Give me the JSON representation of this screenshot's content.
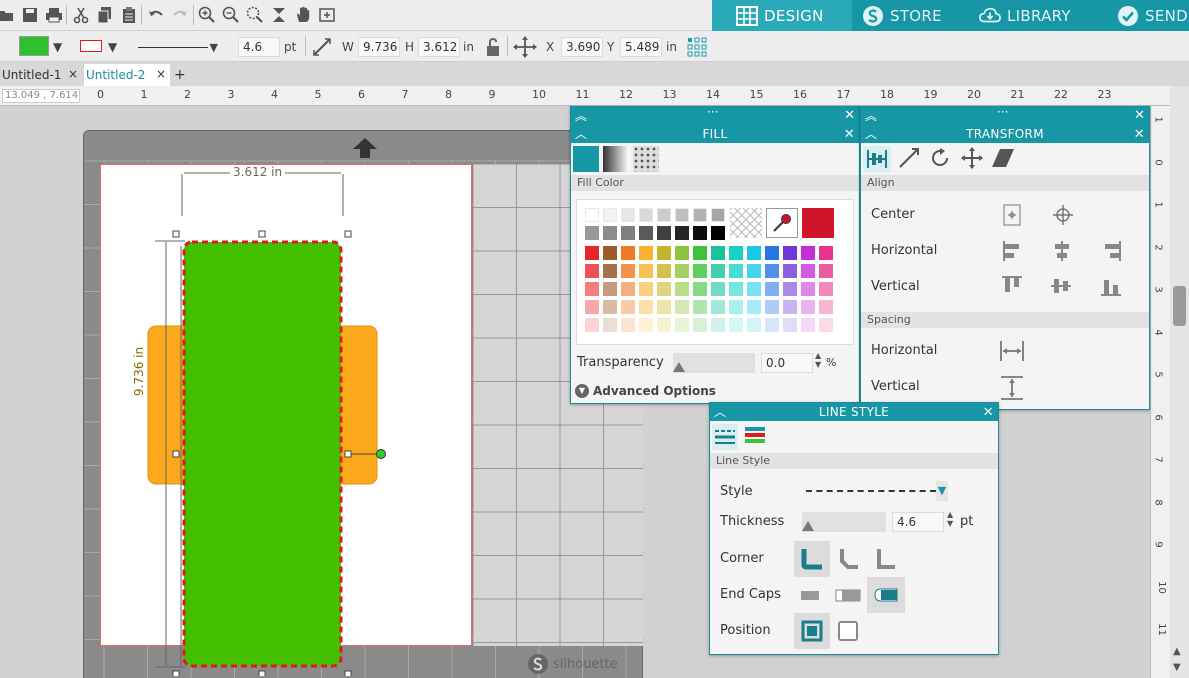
{
  "nav": {
    "design": "DESIGN",
    "store": "STORE",
    "library": "LIBRARY",
    "send": "SEND"
  },
  "propbar": {
    "fill_color": "#2ec02e",
    "line_thickness": "4.6",
    "line_unit": "pt",
    "w_label": "W",
    "w_value": "9.736",
    "h_label": "H",
    "h_value": "3.612",
    "size_unit": "in",
    "x_label": "X",
    "x_value": "3.690",
    "y_label": "Y",
    "y_value": "5.489",
    "pos_unit": "in"
  },
  "tabs": [
    "Untitled-1",
    "Untitled-2"
  ],
  "tab_add": "+",
  "tab_close": "×",
  "coords": "13.049 , 7.614",
  "ruler": {
    "h": [
      "0",
      "1",
      "2",
      "3",
      "4",
      "5",
      "6",
      "7",
      "8",
      "9",
      "10",
      "11",
      "12",
      "13",
      "14",
      "15",
      "16",
      "17",
      "18",
      "19",
      "20",
      "21",
      "22",
      "23"
    ],
    "v": [
      "1",
      "0",
      "1",
      "2",
      "3",
      "4",
      "5",
      "6",
      "7",
      "8",
      "9",
      "10",
      "11"
    ]
  },
  "canvas": {
    "width_dim": "3.612 in",
    "height_dim": "9.736 in",
    "logo": "silhouette",
    "green": "#43c000",
    "orange": "#fba81a",
    "dash": "#e0191f"
  },
  "fill_panel": {
    "title": "FILL",
    "section": "Fill Color",
    "transparency_label": "Transparency",
    "transparency_value": "0.0",
    "transparency_unit": "%",
    "advanced": "Advanced Options",
    "current_color": "#cf1628",
    "palette": [
      [
        "#ffffff",
        "#f2f2f2",
        "#e6e6e6",
        "#d9d9d9",
        "#cccccc",
        "#bfbfbf",
        "#b3b3b3",
        "#a6a6a6"
      ],
      [
        "#999999",
        "#8c8c8c",
        "#7f7f7f",
        "#595959",
        "#404040",
        "#262626",
        "#0d0d0d",
        "#000000"
      ],
      [
        "#e6262b",
        "#9a5a2e",
        "#ee7b23",
        "#f7b233",
        "#c2b42b",
        "#8cc43f",
        "#3ec23e",
        "#1bc19a",
        "#18d1c7",
        "#1ac7e4",
        "#2677e5",
        "#6d36d9",
        "#c62ed8",
        "#e8348b"
      ],
      [
        "#ef5052",
        "#a66f4e",
        "#f2924b",
        "#f8c154",
        "#d1c34d",
        "#a3d061",
        "#60cd5f",
        "#41cfad",
        "#45dcd4",
        "#47d3ed",
        "#5090ea",
        "#8b5fe0",
        "#d25be0",
        "#ed5ca1"
      ],
      [
        "#f37d7e",
        "#c69a7d",
        "#f6ae7b",
        "#fad07f",
        "#dfd47d",
        "#bcdc8a",
        "#87d986",
        "#70dbc3",
        "#77e6e0",
        "#78e0f2",
        "#80aff0",
        "#a98ae8",
        "#de88e8",
        "#f28ab9"
      ],
      [
        "#f7a9aa",
        "#d9bba5",
        "#f9caa6",
        "#fce0aa",
        "#ebe3aa",
        "#d3e8b2",
        "#aee6ad",
        "#a0e8d7",
        "#a7efeb",
        "#a8eaf6",
        "#adcdf5",
        "#c8b5f0",
        "#e9b4f0",
        "#f6b6d2"
      ],
      [
        "#fbd3d4",
        "#ecddd2",
        "#fce4d2",
        "#fdf0d4",
        "#f5f1d4",
        "#e9f3d8",
        "#d6f2d5",
        "#cff3ea",
        "#d3f7f5",
        "#d3f4fb",
        "#d6e6fa",
        "#e3daf7",
        "#f4d9f7",
        "#fadae8"
      ]
    ]
  },
  "transform_panel": {
    "title": "TRANSFORM",
    "align_section": "Align",
    "center": "Center",
    "horizontal": "Horizontal",
    "vertical": "Vertical",
    "spacing_section": "Spacing",
    "sp_horizontal": "Horizontal",
    "sp_vertical": "Vertical"
  },
  "linestyle_panel": {
    "title": "LINE STYLE",
    "section": "Line Style",
    "style": "Style",
    "thickness": "Thickness",
    "thickness_value": "4.6",
    "thickness_unit": "pt",
    "corner": "Corner",
    "end_caps": "End Caps",
    "position": "Position"
  }
}
